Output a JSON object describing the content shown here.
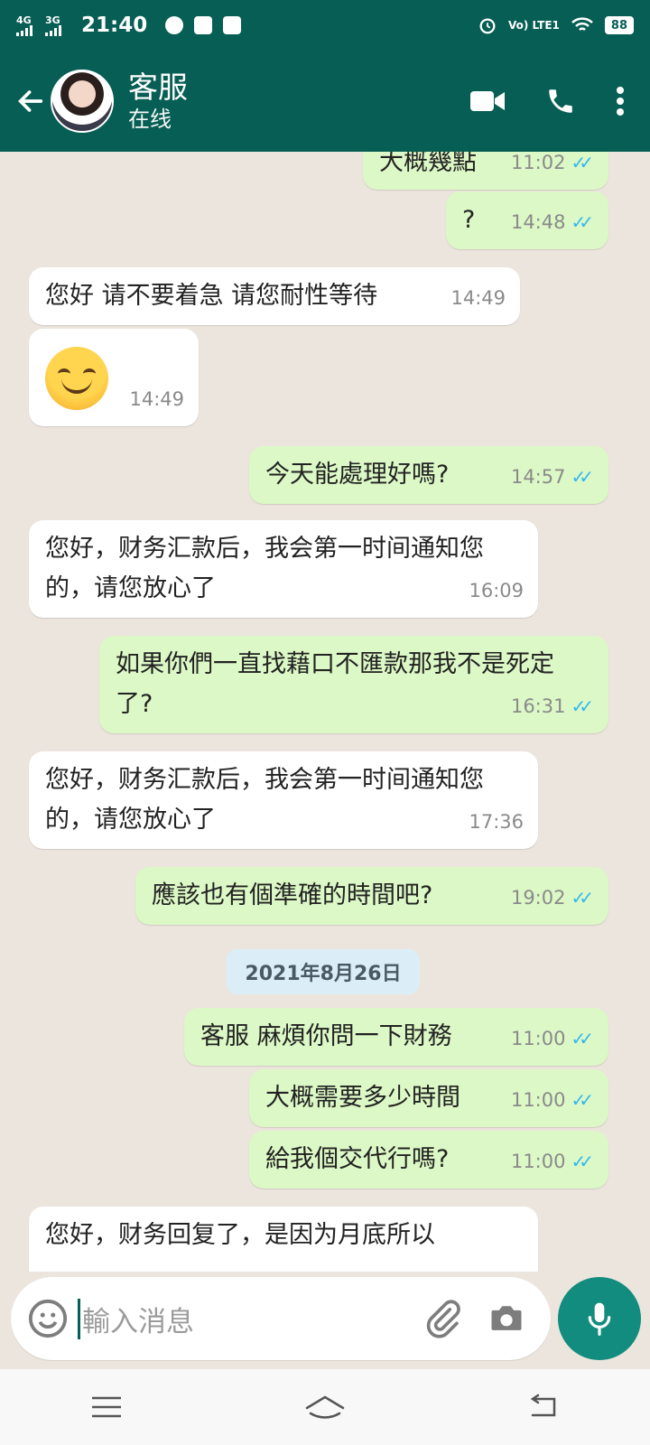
{
  "status_bar": {
    "net1": "4G",
    "net2": "3G",
    "time": "21:40",
    "volte": "Vo) LTE1",
    "battery": "88"
  },
  "header": {
    "contact_name": "客服",
    "contact_status": "在线"
  },
  "messages": [
    {
      "text": "大概幾點",
      "time": "11:02",
      "dir": "out"
    },
    {
      "text": "?",
      "time": "14:48",
      "dir": "out"
    },
    {
      "text": "您好 请不要着急 请您耐性等待",
      "time": "14:49",
      "dir": "in"
    },
    {
      "text": "",
      "time": "14:49",
      "dir": "in",
      "emoji": "smiling-face"
    },
    {
      "text": "今天能處理好嗎?",
      "time": "14:57",
      "dir": "out"
    },
    {
      "text": "您好，财务汇款后，我会第一时间通知您的，请您放心了",
      "time": "16:09",
      "dir": "in"
    },
    {
      "text": "如果你們一直找藉口不匯款那我不是死定了?",
      "time": "16:31",
      "dir": "out"
    },
    {
      "text": "您好，财务汇款后，我会第一时间通知您的，请您放心了",
      "time": "17:36",
      "dir": "in"
    },
    {
      "text": "應該也有個準確的時間吧?",
      "time": "19:02",
      "dir": "out"
    },
    {
      "text": "客服 麻煩你問一下財務",
      "time": "11:00",
      "dir": "out"
    },
    {
      "text": "大概需要多少時間",
      "time": "11:00",
      "dir": "out"
    },
    {
      "text": "給我個交代行嗎?",
      "time": "11:00",
      "dir": "out"
    },
    {
      "text": "您好，财务回复了，是因为月底所以",
      "time": "",
      "dir": "in"
    }
  ],
  "date_chip": "2021年8月26日",
  "composer": {
    "placeholder": "輸入消息"
  },
  "colors": {
    "header": "#075e54",
    "outgoing": "#dcf8c6",
    "incoming": "#ffffff",
    "mic": "#128c7e",
    "ticks": "#34b7f1"
  }
}
